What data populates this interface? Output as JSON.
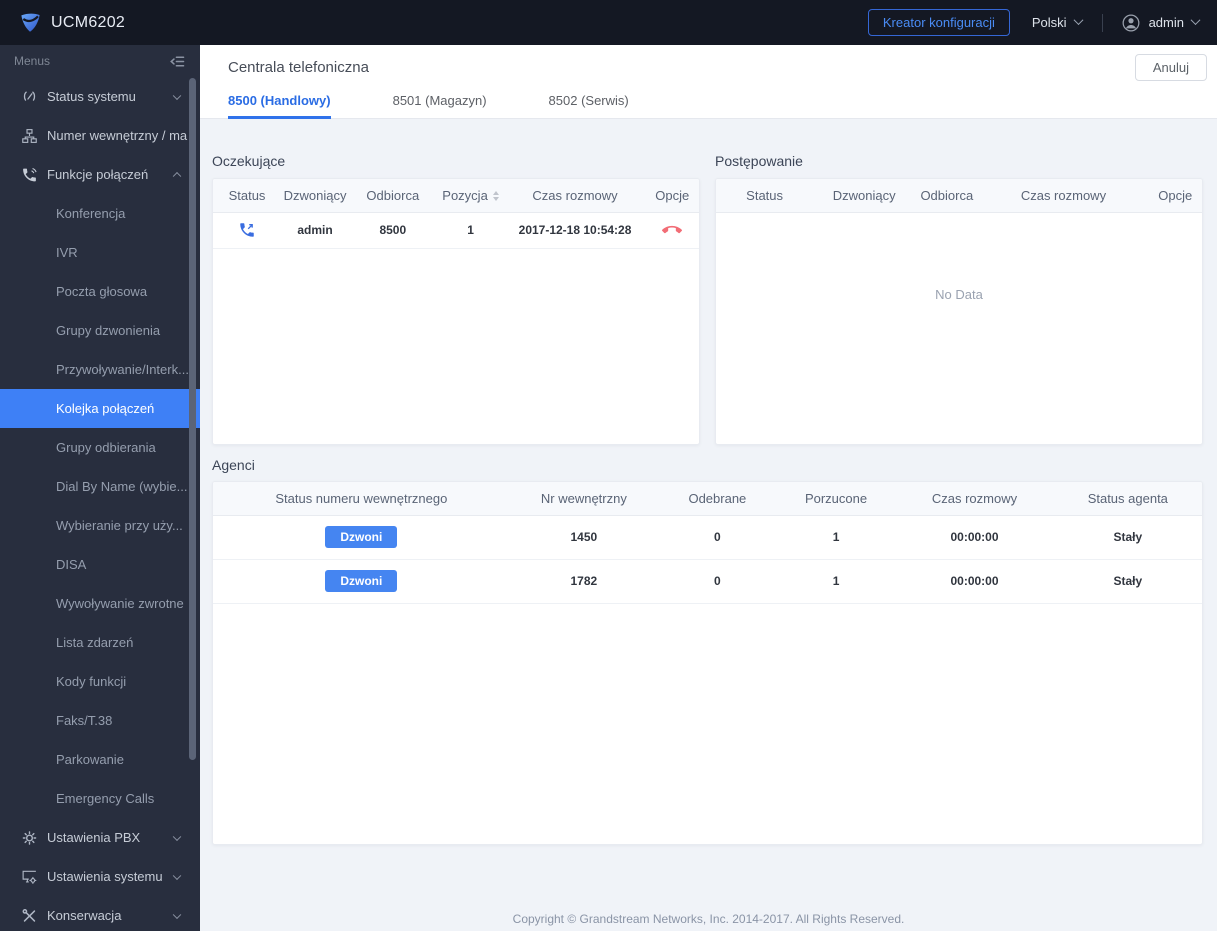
{
  "topbar": {
    "product": "UCM6202",
    "wizard_button": "Kreator konfiguracji",
    "language": "Polski",
    "user": "admin"
  },
  "sidebar": {
    "title": "Menus",
    "items": [
      {
        "label": "Status systemu",
        "icon": "dashboard-icon",
        "level": 0,
        "chevron": "down"
      },
      {
        "label": "Numer wewnętrzny / ma",
        "icon": "extension-trunk-icon",
        "level": 0
      },
      {
        "label": "Funkcje połączeń",
        "icon": "call-features-icon",
        "level": 0,
        "chevron": "up"
      },
      {
        "label": "Konferencja",
        "level": 1
      },
      {
        "label": "IVR",
        "level": 1
      },
      {
        "label": "Poczta głosowa",
        "level": 1
      },
      {
        "label": "Grupy dzwonienia",
        "level": 1
      },
      {
        "label": "Przywoływanie/Interk...",
        "level": 1
      },
      {
        "label": "Kolejka połączeń",
        "level": 1,
        "selected": true
      },
      {
        "label": "Grupy odbierania",
        "level": 1
      },
      {
        "label": "Dial By Name (wybie...",
        "level": 1
      },
      {
        "label": "Wybieranie przy uży...",
        "level": 1
      },
      {
        "label": "DISA",
        "level": 1
      },
      {
        "label": "Wywoływanie zwrotne",
        "level": 1
      },
      {
        "label": "Lista zdarzeń",
        "level": 1
      },
      {
        "label": "Kody funkcji",
        "level": 1
      },
      {
        "label": "Faks/T.38",
        "level": 1
      },
      {
        "label": "Parkowanie",
        "level": 1
      },
      {
        "label": "Emergency Calls",
        "level": 1
      },
      {
        "label": "Ustawienia PBX",
        "icon": "pbx-settings-icon",
        "level": 0,
        "chevron": "down"
      },
      {
        "label": "Ustawienia systemu",
        "icon": "system-settings-icon",
        "level": 0,
        "chevron": "down"
      },
      {
        "label": "Konserwacja",
        "icon": "maintenance-icon",
        "level": 0,
        "chevron": "down"
      }
    ]
  },
  "main": {
    "title": "Centrala telefoniczna",
    "cancel_button": "Anuluj",
    "tabs": [
      {
        "label": "8500 (Handlowy)",
        "active": true
      },
      {
        "label": "8501 (Magazyn)",
        "active": false
      },
      {
        "label": "8502 (Serwis)",
        "active": false
      }
    ],
    "waiting": {
      "title": "Oczekujące",
      "columns": [
        "Status",
        "Dzwoniący",
        "Odbiorca",
        "Pozycja",
        "Czas rozmowy",
        "Opcje"
      ],
      "rows": [
        {
          "status_icon": "active-call-icon",
          "caller": "admin",
          "callee": "8500",
          "position": "1",
          "time": "2017-12-18 10:54:28",
          "action_icon": "hangup-icon"
        }
      ]
    },
    "proceeding": {
      "title": "Postępowanie",
      "columns": [
        "Status",
        "Dzwoniący",
        "Odbiorca",
        "Czas rozmowy",
        "Opcje"
      ],
      "empty": "No Data"
    },
    "agents": {
      "title": "Agenci",
      "columns": [
        "Status numeru wewnętrznego",
        "Nr wewnętrzny",
        "Odebrane",
        "Porzucone",
        "Czas rozmowy",
        "Status agenta"
      ],
      "rows": [
        {
          "status": "Dzwoni",
          "extension": "1450",
          "answered": "0",
          "abandoned": "1",
          "time": "00:00:00",
          "agent_status": "Stały"
        },
        {
          "status": "Dzwoni",
          "extension": "1782",
          "answered": "0",
          "abandoned": "1",
          "time": "00:00:00",
          "agent_status": "Stały"
        }
      ]
    }
  },
  "footer": "Copyright © Grandstream Networks, Inc. 2014-2017. All Rights Reserved.",
  "colors": {
    "topbar_bg": "#141823",
    "sidebar_bg": "#282e3e",
    "selected_item": "#3e80f6",
    "active_tab": "#2a6ce4",
    "badge": "#4585f1",
    "call_icon": "#3a6de0",
    "hangup_icon": "#f26d76",
    "content_bg": "#f0f3f8"
  }
}
